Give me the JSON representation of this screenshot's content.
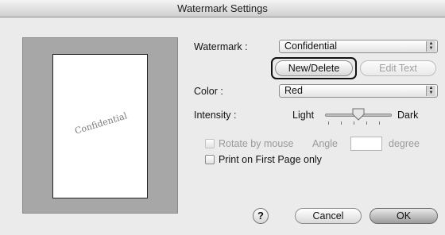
{
  "window": {
    "title": "Watermark Settings"
  },
  "preview": {
    "watermark_text": "Confidential"
  },
  "watermark": {
    "label": "Watermark :",
    "selected": "Confidential"
  },
  "buttons": {
    "new_delete": "New/Delete",
    "edit_text": "Edit Text",
    "cancel": "Cancel",
    "ok": "OK",
    "help": "?"
  },
  "color": {
    "label": "Color :",
    "selected": "Red"
  },
  "intensity": {
    "label": "Intensity :",
    "light": "Light",
    "dark": "Dark",
    "level": 0.5
  },
  "rotate": {
    "label": "Rotate by mouse",
    "checked": false,
    "enabled": false
  },
  "angle": {
    "label": "Angle",
    "value": "",
    "unit": "degree"
  },
  "print_first_page": {
    "label": "Print on First Page only",
    "checked": false
  },
  "icons": {
    "select_arrows": "up-down-arrows-icon",
    "slider_thumb": "slider-thumb-icon",
    "help": "help-icon"
  }
}
